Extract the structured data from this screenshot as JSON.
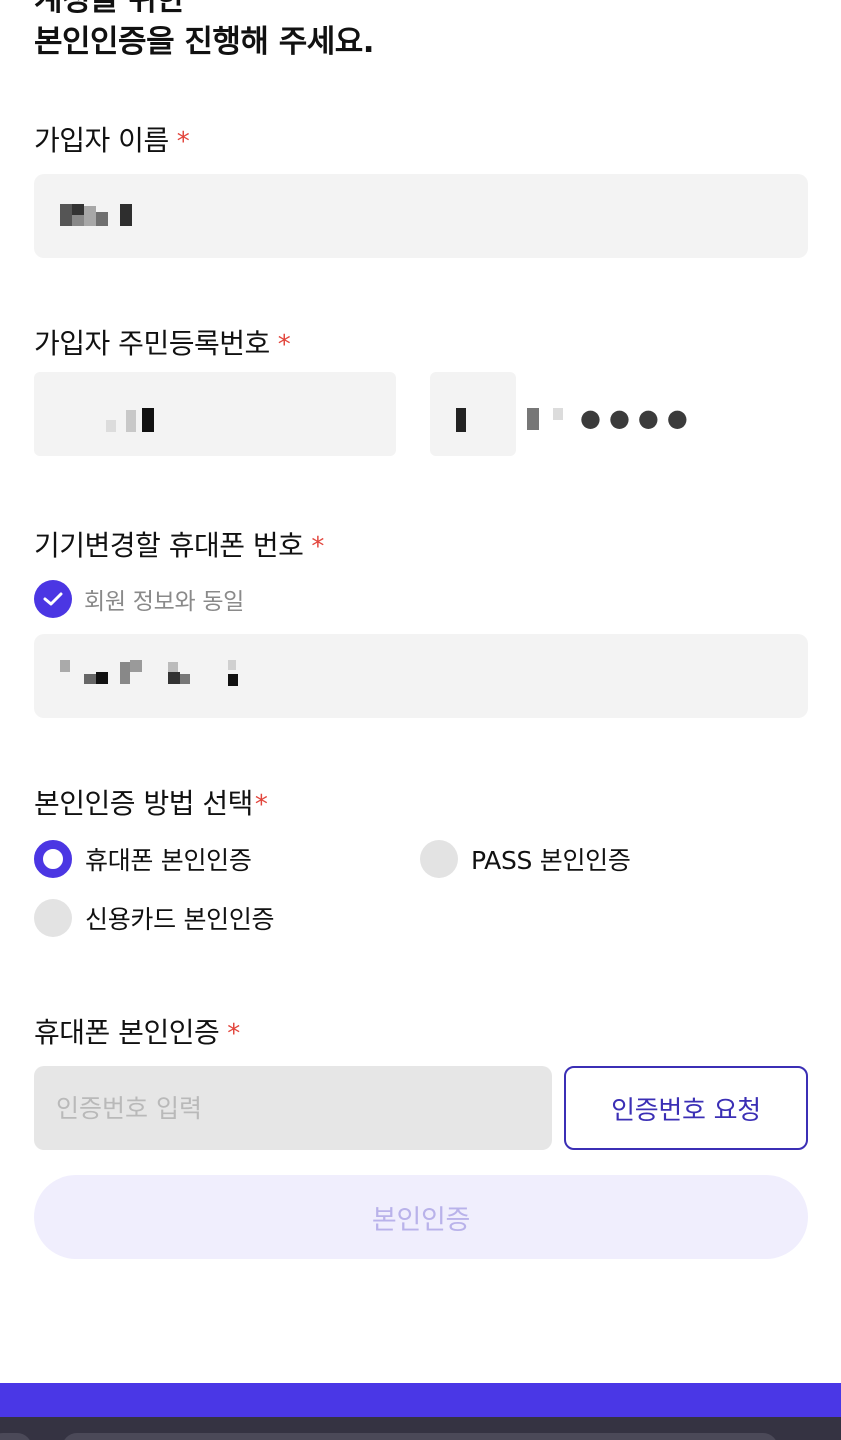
{
  "heading": {
    "line1": "계정을 위한",
    "line2": "본인인증을 진행해 주세요."
  },
  "name_field": {
    "label": "가입자 이름",
    "required_mark": "*",
    "value_masked": true
  },
  "rrn_field": {
    "label": "가입자 주민등록번호",
    "required_mark": "*",
    "masked_dots": "●●●●"
  },
  "phone_field": {
    "label": "기기변경할 휴대폰 번호",
    "required_mark": "*",
    "same_as_member": {
      "label": "회원 정보와 동일",
      "checked": true
    }
  },
  "method": {
    "label": "본인인증 방법 선택",
    "required_mark": "*",
    "options": [
      {
        "label": "휴대폰 본인인증",
        "selected": true
      },
      {
        "label": "PASS 본인인증",
        "selected": false
      },
      {
        "label": "신용카드 본인인증",
        "selected": false
      }
    ]
  },
  "phone_verify": {
    "label": "휴대폰 본인인증",
    "required_mark": "*",
    "code_placeholder": "인증번호 입력",
    "request_button": "인증번호 요청"
  },
  "submit_button": "본인인증",
  "colors": {
    "accent": "#4b36e3",
    "required": "#e2453c",
    "field_bg": "#f3f3f3",
    "disabled_button_bg": "#f0eefd",
    "disabled_button_text": "#b9b2ea"
  }
}
